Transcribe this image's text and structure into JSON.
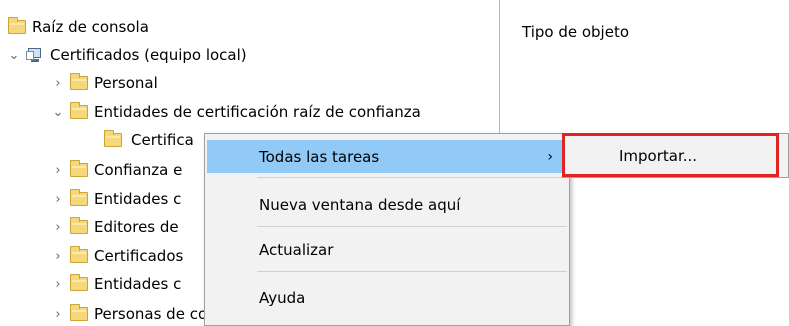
{
  "tree": {
    "root": "Raíz de consola",
    "certificates": "Certificados (equipo local)",
    "personal": "Personal",
    "trusted_root": "Entidades de certificación raíz de confianza",
    "certs_child": "Certifica",
    "enterprise_trust": "Confianza e",
    "intermediate": "Entidades c",
    "publishers": "Editores de",
    "untrusted": "Certificados",
    "third_party": "Entidades c",
    "trusted_people": "Personas de confianza"
  },
  "right_pane": {
    "column_header": "Tipo de objeto"
  },
  "context_menu": {
    "all_tasks": "Todas las tareas",
    "new_window": "Nueva ventana desde aquí",
    "refresh": "Actualizar",
    "help": "Ayuda"
  },
  "submenu": {
    "import": "Importar..."
  },
  "colors": {
    "highlight": "#91c9f7",
    "annotation_border": "#e02424",
    "menu_bg": "#f2f2f2"
  }
}
